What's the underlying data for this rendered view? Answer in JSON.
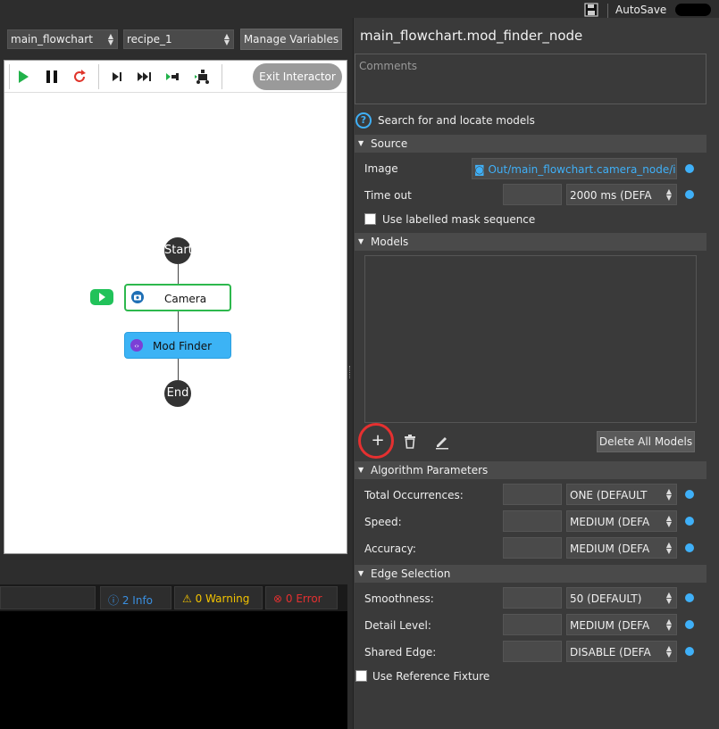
{
  "topbar": {
    "autosave_label": "AutoSave"
  },
  "left": {
    "flowchart_select": "main_flowchart",
    "recipe_select": "recipe_1",
    "manage_variables": "Manage Variables",
    "exit_interactor": "Exit Interactor"
  },
  "flow": {
    "start": "Start",
    "camera": "Camera",
    "mod_finder": "Mod Finder",
    "end": "End"
  },
  "logs": {
    "info": "2 Info",
    "warning": "0 Warning",
    "error": "0 Error"
  },
  "panel": {
    "title": "main_flowchart.mod_finder_node",
    "comments_placeholder": "Comments",
    "help_text": "Search for and locate models",
    "source": {
      "header": "Source",
      "image_label": "Image",
      "image_value": "Out/main_flowchart.camera_node/im",
      "timeout_label": "Time out",
      "timeout_value": "2000 ms (DEFA",
      "labelled_mask": "Use labelled mask sequence"
    },
    "models": {
      "header": "Models",
      "delete_all": "Delete All Models"
    },
    "algorithm": {
      "header": "Algorithm Parameters",
      "total_label": "Total Occurrences:",
      "total_value": "ONE (DEFAULT",
      "speed_label": "Speed:",
      "speed_value": "MEDIUM (DEFA",
      "accuracy_label": "Accuracy:",
      "accuracy_value": "MEDIUM (DEFA"
    },
    "edge": {
      "header": "Edge Selection",
      "smoothness_label": "Smoothness:",
      "smoothness_value": "50 (DEFAULT)",
      "detail_label": "Detail Level:",
      "detail_value": "MEDIUM (DEFA",
      "shared_label": "Shared Edge:",
      "shared_value": "DISABLE (DEFA"
    },
    "reference_fixture": "Use Reference Fixture"
  },
  "colors": {
    "accent": "#3fb0f8",
    "start_green": "#2db84d",
    "node_blue": "#3cb3f5",
    "highlight": "#e53030"
  }
}
